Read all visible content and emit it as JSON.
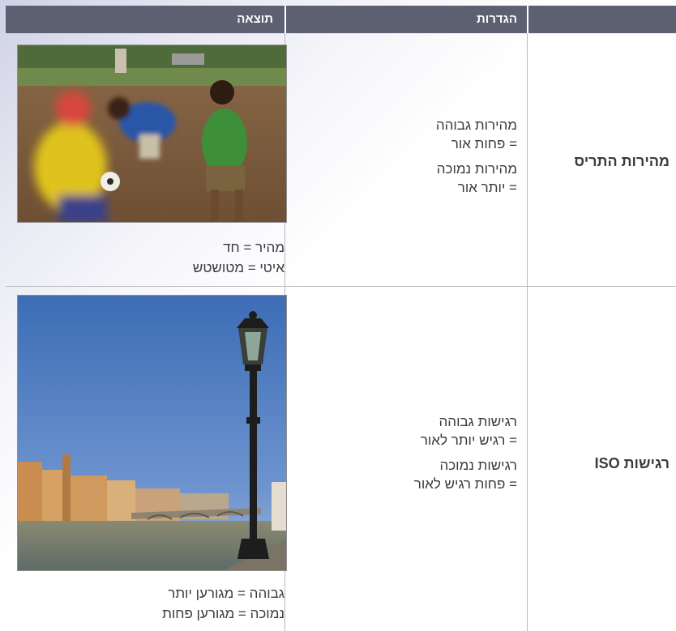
{
  "header": {
    "col_result": "תוצאה",
    "col_settings": "הגדרות",
    "col_label": ""
  },
  "rows": [
    {
      "label": "מהירות התריס",
      "settings": {
        "line1": "מהירות גבוהה",
        "line2": "= פחות אור",
        "line3": "מהירות נמוכה",
        "line4": "= יותר אור"
      },
      "caption": {
        "line1": "מהיר = חד",
        "line2": "איטי = מטושטש"
      },
      "image": "children-playing-soccer-motion-blur-photo"
    },
    {
      "label": "רגישות ISO",
      "settings": {
        "line1": "רגישות גבוהה",
        "line2": "= רגיש יותר לאור",
        "line3": "רגישות נמוכה",
        "line4": "= פחות רגיש לאור"
      },
      "caption": {
        "line1": "גבוהה = מגורען יותר",
        "line2": "נמוכה = מגורען פחות"
      },
      "image": "street-lamp-river-bridge-photo"
    }
  ],
  "colors": {
    "header_bg": "#5d6070",
    "header_text": "#ffffff",
    "body_text": "#3a3a40",
    "grid_line": "#b8b8be"
  }
}
